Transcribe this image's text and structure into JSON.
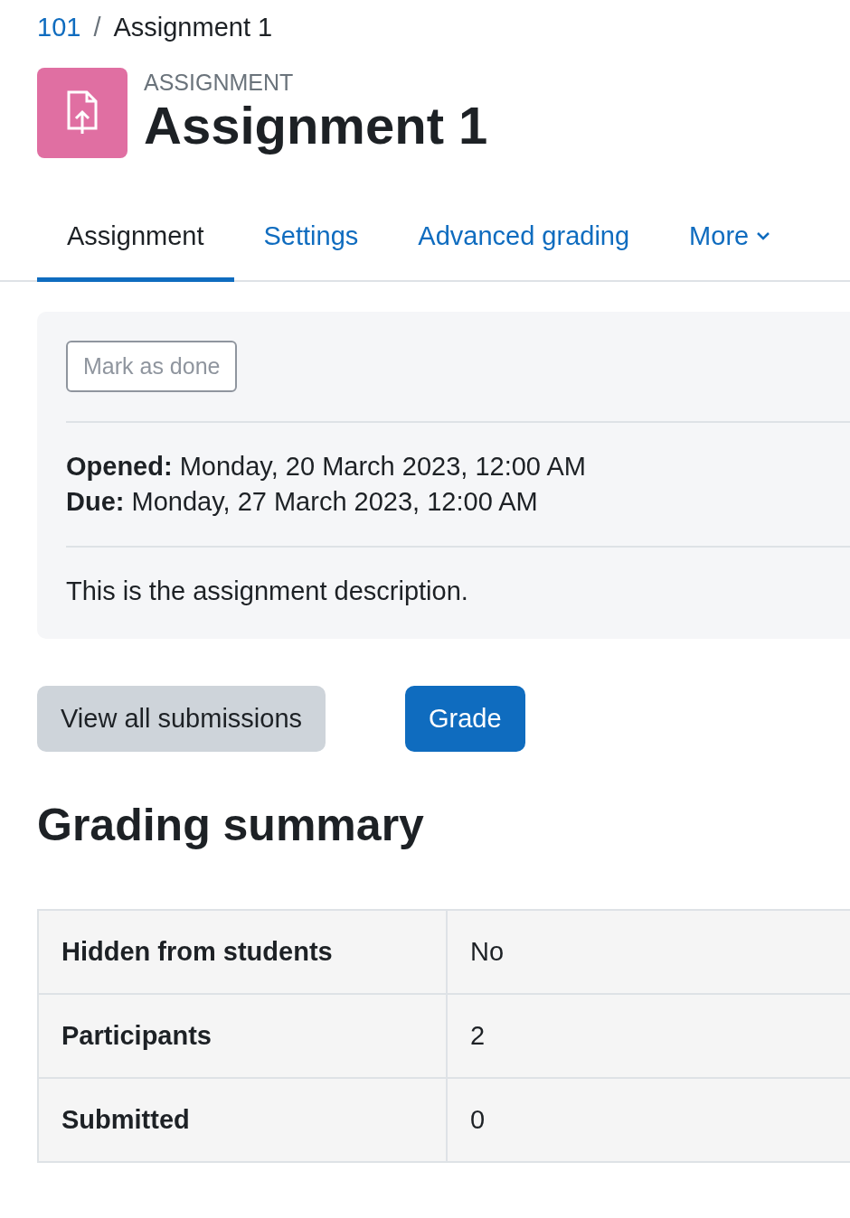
{
  "breadcrumb": [
    {
      "label": "101",
      "link": true
    },
    {
      "separator": "/",
      "label": "Assignment 1",
      "link": false
    }
  ],
  "header": {
    "kind_label": "ASSIGNMENT",
    "title": "Assignment 1"
  },
  "tabs": [
    {
      "label": "Assignment",
      "selected": true,
      "dropdown": false
    },
    {
      "label": "Settings",
      "selected": false,
      "dropdown": false
    },
    {
      "label": "Advanced grading",
      "selected": false,
      "dropdown": false
    },
    {
      "label": "More",
      "selected": false,
      "dropdown": true
    }
  ],
  "activity": {
    "mark_button": "Mark as done",
    "dates": [
      {
        "label": "Opened:",
        "value": "Monday, 20 March 2023, 12:00 AM"
      },
      {
        "label": "Due:",
        "value": "Monday, 27 March 2023, 12:00 AM"
      }
    ],
    "description": "This is the assignment description."
  },
  "actions": [
    {
      "label": "View all submissions",
      "kind": "secondary"
    },
    {
      "label": "Grade",
      "kind": "primary"
    }
  ],
  "summary": {
    "heading": "Grading summary",
    "rows": [
      {
        "label": "Hidden from students",
        "value": "No"
      },
      {
        "label": "Participants",
        "value": "2"
      },
      {
        "label": "Submitted",
        "value": "0"
      }
    ]
  }
}
